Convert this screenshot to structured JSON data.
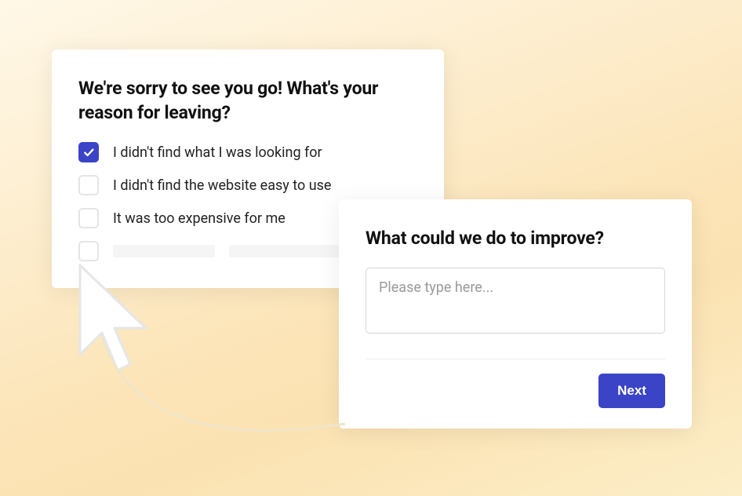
{
  "survey1": {
    "title": "We're sorry to see you go! What's your reason for leaving?",
    "options": [
      {
        "label": "I didn't find what I was looking for",
        "checked": true
      },
      {
        "label": "I didn't find the website easy to use",
        "checked": false
      },
      {
        "label": "It was too expensive for me",
        "checked": false
      }
    ]
  },
  "survey2": {
    "title": "What could we do to improve?",
    "placeholder": "Please type here...",
    "next_label": "Next"
  }
}
